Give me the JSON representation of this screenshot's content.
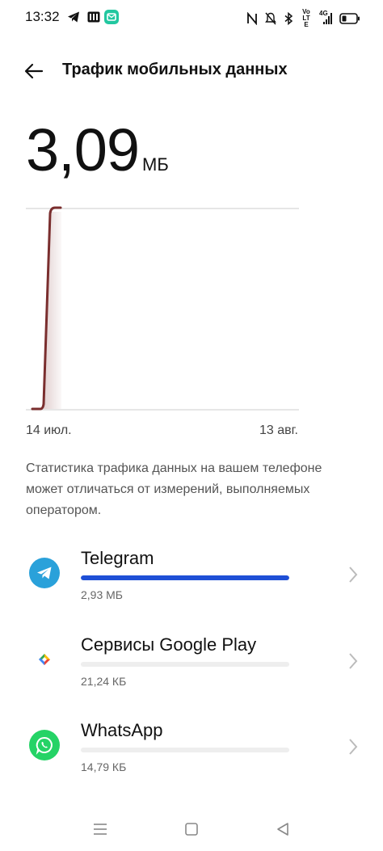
{
  "status_bar": {
    "time": "13:32",
    "left_icons": [
      "telegram-icon",
      "media-icon",
      "message-icon"
    ],
    "right_icons": [
      "nfc-icon",
      "mute-icon",
      "bluetooth-icon",
      "volte-icon",
      "4g-signal-icon",
      "battery-icon"
    ],
    "volte_label": "Vo LTE",
    "network_label": "4G"
  },
  "header": {
    "title": "Трафик мобильных данных"
  },
  "summary": {
    "value": "3,09",
    "unit": "МБ"
  },
  "chart_data": {
    "type": "line",
    "x_start_label": "14 июл.",
    "x_end_label": "13 авг.",
    "description_of_shape": "cumulative usage; flat near 0 at start, sharp rise to maximum on first days, flat thereafter (line shown only over first days)",
    "line_color": "#7a2e2e",
    "grid": true
  },
  "note": "Статистика трафика данных на вашем телефоне может отличаться от измерений, выполняемых оператором.",
  "apps": [
    {
      "name": "Telegram",
      "size": "2,93 МБ",
      "usage_fraction": 1.0,
      "icon": "telegram-icon"
    },
    {
      "name": "Сервисы Google Play",
      "size": "21,24 КБ",
      "usage_fraction": 0.0,
      "icon": "google-play-services-icon"
    },
    {
      "name": "WhatsApp",
      "size": "14,79 КБ",
      "usage_fraction": 0.0,
      "icon": "whatsapp-icon"
    }
  ],
  "colors": {
    "accent": "#1e4fd6",
    "telegram": "#2aa1da",
    "whatsapp": "#25d366",
    "chart_line": "#7a2e2e"
  },
  "nav": {
    "icons": [
      "menu-icon",
      "home-icon",
      "back-icon"
    ]
  }
}
